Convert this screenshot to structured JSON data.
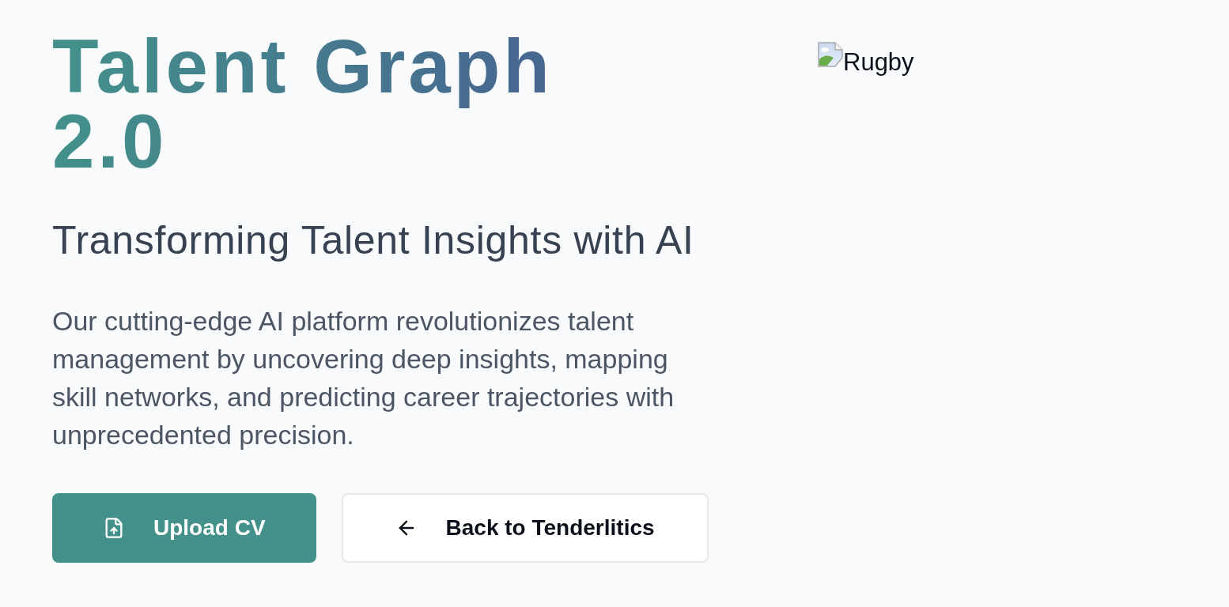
{
  "hero": {
    "title": "Talent Graph 2.0",
    "subtitle": "Transforming Talent Insights with AI",
    "description": "Our cutting-edge AI platform revolutionizes talent management by uncovering deep insights, mapping skill networks, and predicting career trajectories with unprecedented precision.",
    "buttons": [
      {
        "kind": "primary",
        "label": "Upload CV"
      },
      {
        "kind": "secondary",
        "label": "Back to Tenderlitics"
      }
    ]
  },
  "image": {
    "alt": "Rugby"
  }
}
